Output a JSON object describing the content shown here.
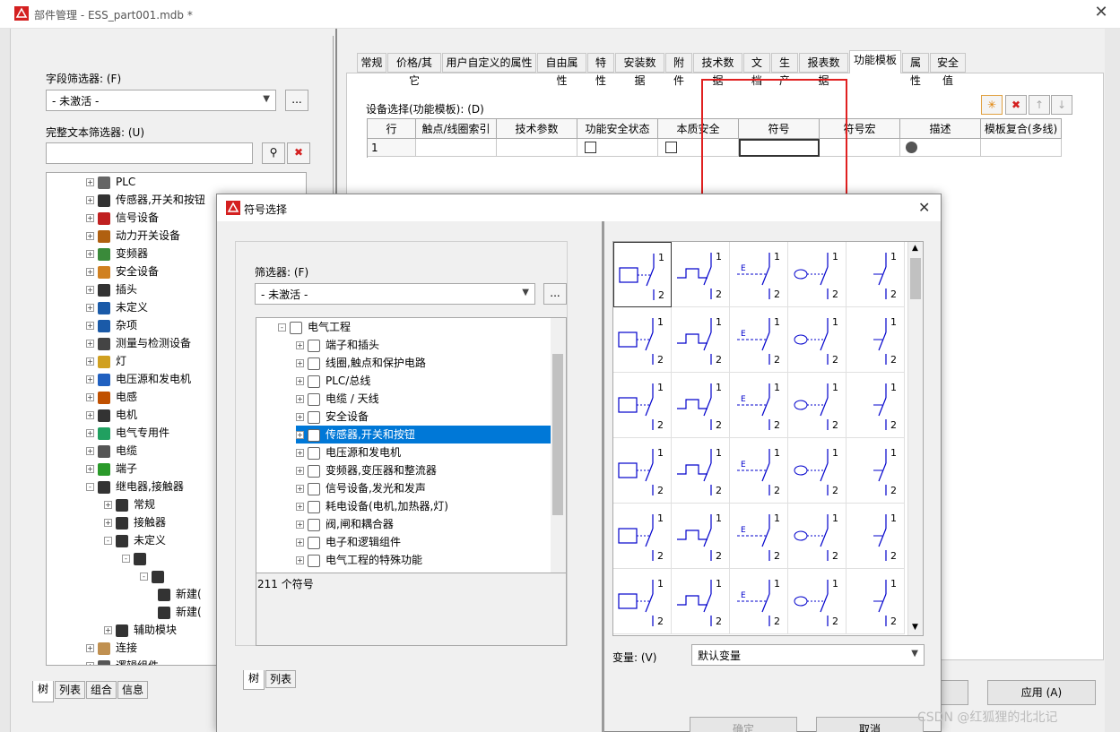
{
  "window": {
    "title": "部件管理 - ESS_part001.mdb *"
  },
  "left": {
    "field_filter_label": "字段筛选器: (F)",
    "field_filter_value": "- 未激活 -",
    "more_btn": "...",
    "fulltext_label": "完整文本筛选器: (U)",
    "tree": [
      {
        "label": "PLC",
        "level": 1,
        "pm": "+"
      },
      {
        "label": "传感器,开关和按钮",
        "level": 1,
        "pm": "+"
      },
      {
        "label": "信号设备",
        "level": 1,
        "pm": "+"
      },
      {
        "label": "动力开关设备",
        "level": 1,
        "pm": "+"
      },
      {
        "label": "变频器",
        "level": 1,
        "pm": "+"
      },
      {
        "label": "安全设备",
        "level": 1,
        "pm": "+"
      },
      {
        "label": "插头",
        "level": 1,
        "pm": "+"
      },
      {
        "label": "未定义",
        "level": 1,
        "pm": "+"
      },
      {
        "label": "杂项",
        "level": 1,
        "pm": "+"
      },
      {
        "label": "测量与检测设备",
        "level": 1,
        "pm": "+"
      },
      {
        "label": "灯",
        "level": 1,
        "pm": "+"
      },
      {
        "label": "电压源和发电机",
        "level": 1,
        "pm": "+"
      },
      {
        "label": "电感",
        "level": 1,
        "pm": "+"
      },
      {
        "label": "电机",
        "level": 1,
        "pm": "+"
      },
      {
        "label": "电气专用件",
        "level": 1,
        "pm": "+"
      },
      {
        "label": "电缆",
        "level": 1,
        "pm": "+"
      },
      {
        "label": "端子",
        "level": 1,
        "pm": "+"
      },
      {
        "label": "继电器,接触器",
        "level": 1,
        "pm": "-"
      },
      {
        "label": "常规",
        "level": 2,
        "pm": "+"
      },
      {
        "label": "接触器",
        "level": 2,
        "pm": "+"
      },
      {
        "label": "未定义",
        "level": 2,
        "pm": "-"
      },
      {
        "label": "",
        "level": 3,
        "pm": "-"
      },
      {
        "label": "",
        "level": 4,
        "pm": "-"
      },
      {
        "label": "新建(",
        "level": 5,
        "pm": ""
      },
      {
        "label": "新建(",
        "level": 5,
        "pm": ""
      },
      {
        "label": "辅助模块",
        "level": 2,
        "pm": "+"
      },
      {
        "label": "连接",
        "level": 1,
        "pm": "+"
      },
      {
        "label": "逻辑组件",
        "level": 1,
        "pm": "+"
      }
    ],
    "bottom_tabs": [
      "树",
      "列表",
      "组合",
      "信息"
    ]
  },
  "right": {
    "tabs": [
      "常规",
      "价格/其它",
      "用户自定义的属性",
      "自由属性",
      "特性",
      "安装数据",
      "附件",
      "技术数据",
      "文档",
      "生产",
      "报表数据",
      "功能模板",
      "属性",
      "安全值"
    ],
    "active_tab": "功能模板",
    "device_select_label": "设备选择(功能模板): (D)",
    "columns": [
      "行",
      "触点/线圈索引",
      "技术参数",
      "功能安全状态",
      "本质安全",
      "符号",
      "符号宏",
      "描述",
      "模板复合(多线)"
    ],
    "row": {
      "index": "1"
    },
    "buttons": {
      "ok": "",
      "apply": "应用 (A)"
    }
  },
  "dialog": {
    "title": "符号选择",
    "filter_label": "筛选器: (F)",
    "filter_value": "- 未激活 -",
    "more_btn": "...",
    "tree_root": "电气工程",
    "tree": [
      "端子和插头",
      "线圈,触点和保护电路",
      "PLC/总线",
      "电缆 / 天线",
      "安全设备",
      "传感器,开关和按钮",
      "电压源和发电机",
      "变频器,变压器和整流器",
      "信号设备,发光和发声",
      "耗电设备(电机,加热器,灯)",
      "阀,闸和耦合器",
      "电子和逻辑组件",
      "电气工程的特殊功能"
    ],
    "selected_item": "传感器,开关和按钮",
    "count_text": "211 个符号",
    "bottom_tabs": [
      "树",
      "列表"
    ],
    "variant_label": "变量: (V)",
    "variant_value": "默认变量",
    "ok_button": "确定",
    "cancel_button": "取消"
  },
  "watermark": "CSDN @红狐狸的北北记",
  "colors": {
    "accent_red": "#e02020",
    "selection_blue": "#0078d7",
    "symbol_blue": "#0000cc"
  }
}
